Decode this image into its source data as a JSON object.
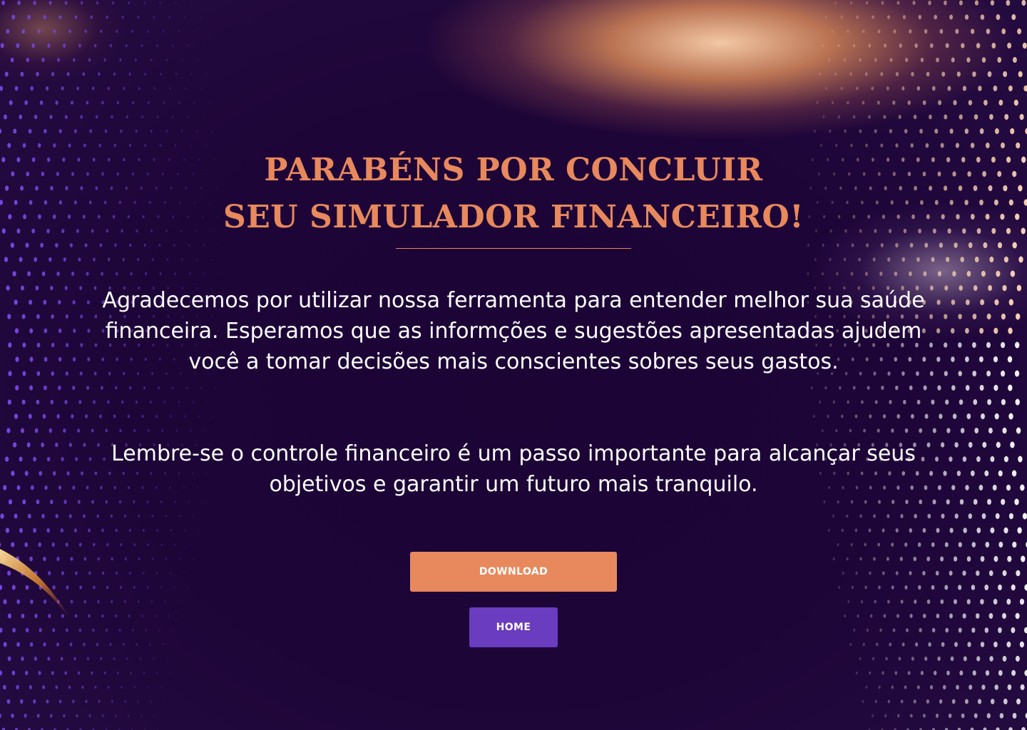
{
  "title": {
    "line1": "PARABÉNS POR CONCLUIR",
    "line2": "SEU SIMULADOR FINANCEIRO!"
  },
  "body": {
    "paragraph1": "Agradecemos por utilizar nossa ferramenta para entender melhor sua saúde financeira. Esperamos que as informções e sugestões apresentadas ajudem você a tomar decisões mais conscientes sobres seus gastos.",
    "paragraph2": "Lembre-se o controle financeiro é um passo importante para alcançar seus objetivos e garantir um futuro mais tranquilo."
  },
  "buttons": {
    "download_label": "DOWNLOAD",
    "home_label": "HOME"
  },
  "colors": {
    "background": "#1e0538",
    "accent_orange": "#e8895d",
    "accent_purple": "#6a3cc0",
    "text": "#ffffff"
  }
}
